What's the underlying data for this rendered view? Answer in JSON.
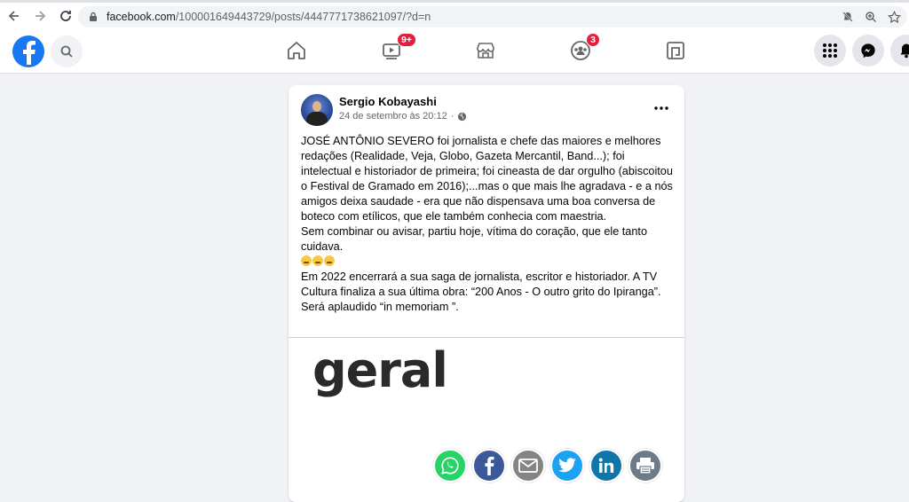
{
  "browser": {
    "url_host": "facebook.com",
    "url_path": "/100001649443729/posts/4447771738621097/?d=n"
  },
  "header": {
    "notifications": {
      "watch_badge": "9+",
      "groups_badge": "3"
    }
  },
  "post": {
    "author": "Sergio Kobayashi",
    "timestamp": "24 de setembro às 20:12",
    "paragraph1": "JOSÉ ANTÔNIO SEVERO foi jornalista e chefe das maiores e melhores redações (Realidade, Veja, Globo, Gazeta Mercantil, Band...); foi intelectual e historiador de primeira; foi cineasta de dar orgulho (abiscoitou o Festival de Gramado em 2016);...mas o que mais lhe agradava - e a nós amigos deixa saudade - era que não dispensava uma boa conversa de boteco com etílicos, que ele também conhecia com maestria.",
    "paragraph2": "Sem combinar ou avisar, partiu hoje, vítima do coração, que ele tanto cuidava.",
    "paragraph3": "Em 2022 encerrará a sua saga de jornalista, escritor e historiador. A TV Cultura finaliza a sua última obra: “200 Anos - O outro grito do Ipiranga”. Será aplaudido “in memoriam ”."
  },
  "preview": {
    "logo_text": "geral"
  },
  "colors": {
    "fb_blue": "#1877f2",
    "badge_red": "#e41e3f",
    "whatsapp": "#25d366",
    "facebook_share": "#3b5998",
    "email": "#848484",
    "twitter": "#1da1f2",
    "linkedin": "#0e76a8",
    "print": "#6d7a87"
  }
}
